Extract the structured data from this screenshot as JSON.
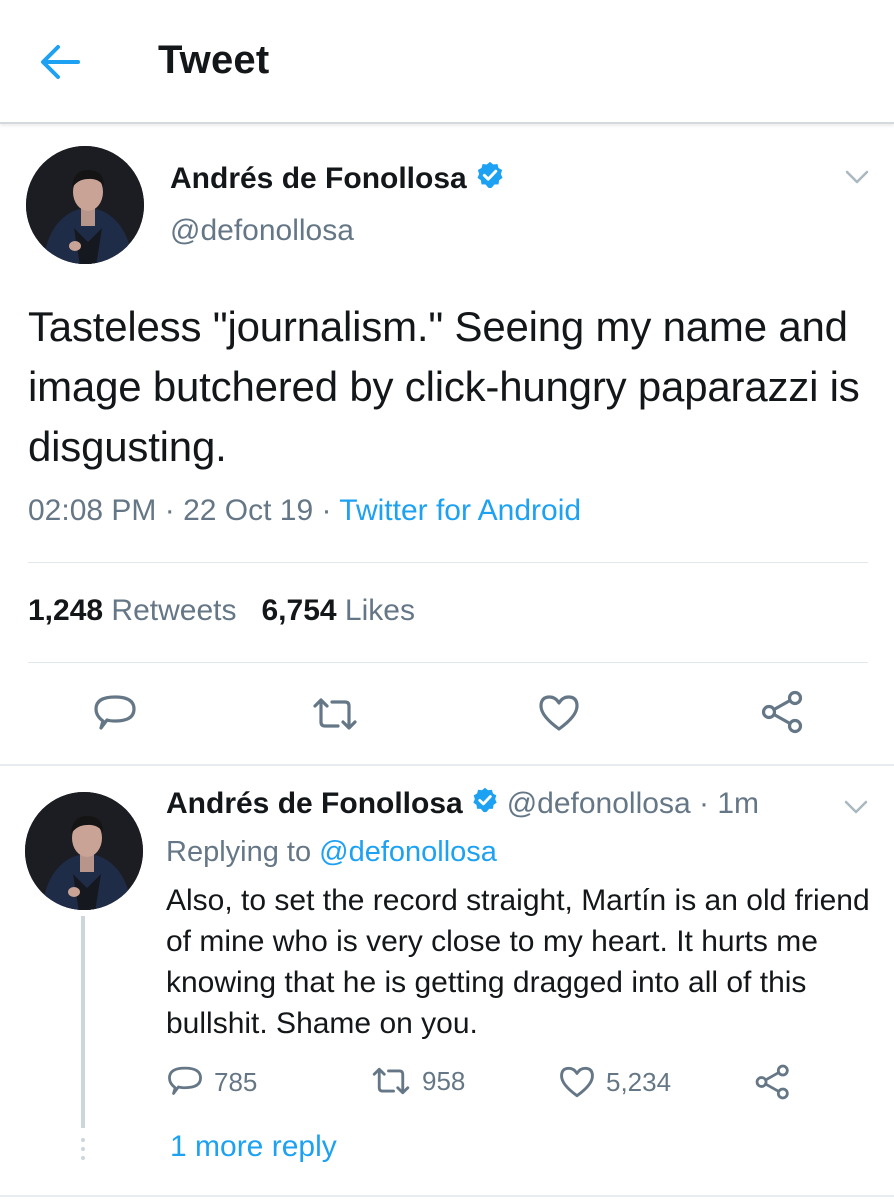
{
  "header": {
    "title": "Tweet"
  },
  "tweet": {
    "author_name": "Andrés de Fonollosa",
    "handle": "@defonollosa",
    "text": "Tasteless \"journalism.\" Seeing my name and image butchered by click-hungry paparazzi is disgusting.",
    "time": "02:08 PM",
    "date": "22 Oct 19",
    "source": "Twitter for Android",
    "retweets": "1,248",
    "retweets_label": "Retweets",
    "likes": "6,754",
    "likes_label": "Likes"
  },
  "reply": {
    "author_name": "Andrés de Fonollosa",
    "handle": "@defonollosa",
    "time_ago": "1m",
    "replying_prefix": "Replying to",
    "replying_to": "@defonollosa",
    "text": "Also, to set the record straight, Martín is an old friend of mine who is very close to my heart. It hurts me knowing that he is getting dragged into all of this bullshit. Shame on you.",
    "reply_count": "785",
    "retweet_count": "958",
    "like_count": "5,234"
  },
  "more_replies": "1 more reply",
  "colors": {
    "accent": "#1da1f2",
    "muted": "#657786",
    "text": "#14171a",
    "icon": "#657786"
  },
  "icons": [
    "back-arrow-icon",
    "verified-badge-icon",
    "chevron-down-icon",
    "reply-icon",
    "retweet-icon",
    "like-icon",
    "share-icon"
  ]
}
